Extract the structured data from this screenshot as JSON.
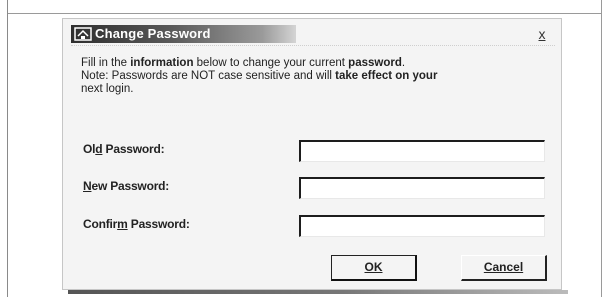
{
  "dialog": {
    "title": "Change Password",
    "close_label": "x",
    "info_line1_pre": "Fill in the ",
    "info_line1_bold1": "information",
    "info_line1_mid": " below to change your current ",
    "info_line1_bold2": "password",
    "info_line1_end": ".",
    "info_line2_pre": "Note: Passwords are NOT case sensitive and will ",
    "info_line2_bold": "take effect on your",
    "info_line3_pre": "next login",
    "info_line3_end": ".",
    "fields": [
      {
        "label_pre": "Ol",
        "label_u": "d",
        "label_post": " Password:",
        "value": ""
      },
      {
        "label_pre": "",
        "label_u": "N",
        "label_post": "ew Password:",
        "value": ""
      },
      {
        "label_pre": "Confir",
        "label_u": "m",
        "label_post": " Password:",
        "value": ""
      }
    ],
    "ok_label": "OK",
    "cancel_label": "Cancel"
  },
  "icons": {
    "title_icon": "password-dialog-icon"
  }
}
